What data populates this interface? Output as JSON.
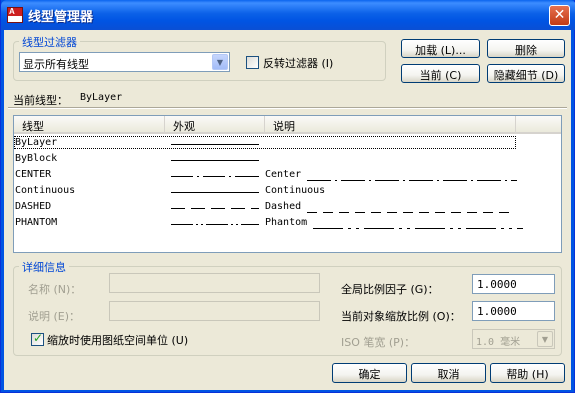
{
  "window": {
    "title": "线型管理器"
  },
  "filter_group": {
    "title": "线型过滤器",
    "combo_value": "显示所有线型",
    "invert_label": "反转过滤器 (I)",
    "invert_checked": false
  },
  "buttons": {
    "load": "加载 (L)...",
    "delete": "删除",
    "current": "当前 (C)",
    "hide_details": "隐藏细节 (D)"
  },
  "current_linetype": {
    "label": "当前线型：",
    "value": "ByLayer"
  },
  "list": {
    "columns": [
      "线型",
      "外观",
      "说明"
    ],
    "rows": [
      {
        "name": "ByLayer",
        "description": "",
        "pattern": "continuous"
      },
      {
        "name": "ByBlock",
        "description": "",
        "pattern": "continuous"
      },
      {
        "name": "CENTER",
        "description": "Center",
        "pattern": "center"
      },
      {
        "name": "Continuous",
        "description": "Continuous",
        "pattern": "continuous"
      },
      {
        "name": "DASHED",
        "description": "Dashed",
        "pattern": "dashed"
      },
      {
        "name": "PHANTOM",
        "description": "Phantom",
        "pattern": "phantom"
      }
    ],
    "selected": "ByLayer"
  },
  "details": {
    "title": "详细信息",
    "name_label": "名称 (N)：",
    "desc_label": "说明 (E)：",
    "paper_space_label": "缩放时使用图纸空间单位 (U)",
    "paper_space_checked": true,
    "global_scale_label": "全局比例因子 (G)：",
    "global_scale_value": "1.0000",
    "object_scale_label": "当前对象缩放比例 (O)：",
    "object_scale_value": "1.0000",
    "iso_pen_label": "ISO 笔宽 (P)：",
    "iso_pen_value": "1.0 毫米"
  },
  "footer": {
    "ok": "确定",
    "cancel": "取消",
    "help": "帮助 (H)"
  }
}
